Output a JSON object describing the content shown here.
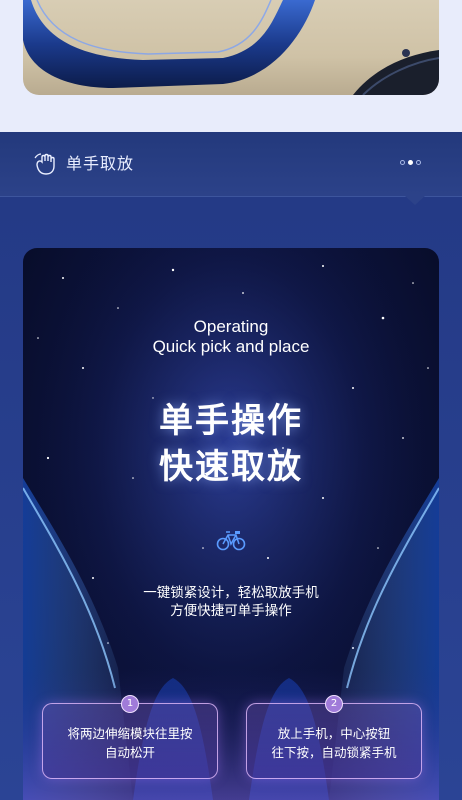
{
  "section": {
    "title": "单手取放",
    "pager": {
      "count": 3,
      "active_index": 1
    },
    "icons": {
      "header": "hand-grab-icon",
      "feature": "bicycle-icon"
    }
  },
  "card": {
    "en_line1": "Operating",
    "en_line2": "Quick pick and place",
    "cn_line1": "单手操作",
    "cn_line2": "快速取放",
    "desc_line1": "一键锁紧设计，轻松取放手机",
    "desc_line2": "方便快捷可单手操作"
  },
  "steps": [
    {
      "number": "1",
      "line1": "将两边伸缩模块往里按",
      "line2": "自动松开"
    },
    {
      "number": "2",
      "line1": "放上手机，中心按钮",
      "line2": "往下按，自动锁紧手机"
    }
  ],
  "colors": {
    "section_bg": "#2a3f8a",
    "accent_purple": "#a07bd9",
    "glow_blue": "#3d8bff"
  }
}
